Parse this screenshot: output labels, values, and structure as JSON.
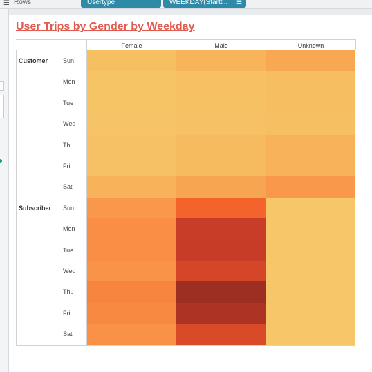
{
  "shelf": {
    "label": "Rows",
    "pills": [
      "Usertype",
      "WEEKDAY(Startti.."
    ]
  },
  "colors": {
    "title": "#e05a4e",
    "pill": "#2e8aa6",
    "scale_low": "#f5c86a",
    "scale_high": "#9c2e22"
  },
  "chart_data": {
    "type": "heatmap",
    "title": "User Trips by Gender by Weekday",
    "columns": [
      "Female",
      "Male",
      "Unknown"
    ],
    "row_groups": [
      {
        "name": "Customer",
        "rows": [
          "Sun",
          "Mon",
          "Tue",
          "Wed",
          "Thu",
          "Fri",
          "Sat"
        ],
        "values": [
          [
            0.2,
            0.25,
            0.31
          ],
          [
            0.15,
            0.19,
            0.21
          ],
          [
            0.15,
            0.18,
            0.21
          ],
          [
            0.14,
            0.17,
            0.2
          ],
          [
            0.17,
            0.22,
            0.26
          ],
          [
            0.17,
            0.22,
            0.26
          ],
          [
            0.26,
            0.32,
            0.38
          ]
        ]
      },
      {
        "name": "Subscriber",
        "rows": [
          "Sun",
          "Mon",
          "Tue",
          "Wed",
          "Thu",
          "Fri",
          "Sat"
        ],
        "values": [
          [
            0.38,
            0.6,
            0.11
          ],
          [
            0.42,
            0.82,
            0.11
          ],
          [
            0.42,
            0.83,
            0.11
          ],
          [
            0.4,
            0.76,
            0.11
          ],
          [
            0.46,
            1.0,
            0.11
          ],
          [
            0.44,
            0.93,
            0.11
          ],
          [
            0.41,
            0.74,
            0.11
          ]
        ]
      }
    ]
  }
}
